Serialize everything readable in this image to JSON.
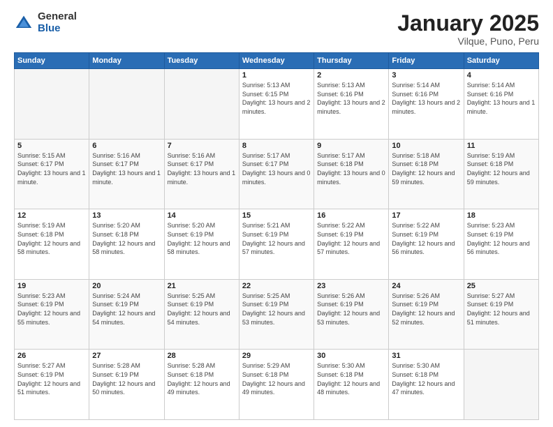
{
  "header": {
    "logo_general": "General",
    "logo_blue": "Blue",
    "month_title": "January 2025",
    "location": "Vilque, Puno, Peru"
  },
  "weekdays": [
    "Sunday",
    "Monday",
    "Tuesday",
    "Wednesday",
    "Thursday",
    "Friday",
    "Saturday"
  ],
  "weeks": [
    [
      {
        "day": "",
        "empty": true
      },
      {
        "day": "",
        "empty": true
      },
      {
        "day": "",
        "empty": true
      },
      {
        "day": "1",
        "sunrise": "5:13 AM",
        "sunset": "6:15 PM",
        "daylight": "13 hours and 2 minutes."
      },
      {
        "day": "2",
        "sunrise": "5:13 AM",
        "sunset": "6:16 PM",
        "daylight": "13 hours and 2 minutes."
      },
      {
        "day": "3",
        "sunrise": "5:14 AM",
        "sunset": "6:16 PM",
        "daylight": "13 hours and 2 minutes."
      },
      {
        "day": "4",
        "sunrise": "5:14 AM",
        "sunset": "6:16 PM",
        "daylight": "13 hours and 1 minute."
      }
    ],
    [
      {
        "day": "5",
        "sunrise": "5:15 AM",
        "sunset": "6:17 PM",
        "daylight": "13 hours and 1 minute."
      },
      {
        "day": "6",
        "sunrise": "5:16 AM",
        "sunset": "6:17 PM",
        "daylight": "13 hours and 1 minute."
      },
      {
        "day": "7",
        "sunrise": "5:16 AM",
        "sunset": "6:17 PM",
        "daylight": "13 hours and 1 minute."
      },
      {
        "day": "8",
        "sunrise": "5:17 AM",
        "sunset": "6:17 PM",
        "daylight": "13 hours and 0 minutes."
      },
      {
        "day": "9",
        "sunrise": "5:17 AM",
        "sunset": "6:18 PM",
        "daylight": "13 hours and 0 minutes."
      },
      {
        "day": "10",
        "sunrise": "5:18 AM",
        "sunset": "6:18 PM",
        "daylight": "12 hours and 59 minutes."
      },
      {
        "day": "11",
        "sunrise": "5:19 AM",
        "sunset": "6:18 PM",
        "daylight": "12 hours and 59 minutes."
      }
    ],
    [
      {
        "day": "12",
        "sunrise": "5:19 AM",
        "sunset": "6:18 PM",
        "daylight": "12 hours and 58 minutes."
      },
      {
        "day": "13",
        "sunrise": "5:20 AM",
        "sunset": "6:18 PM",
        "daylight": "12 hours and 58 minutes."
      },
      {
        "day": "14",
        "sunrise": "5:20 AM",
        "sunset": "6:19 PM",
        "daylight": "12 hours and 58 minutes."
      },
      {
        "day": "15",
        "sunrise": "5:21 AM",
        "sunset": "6:19 PM",
        "daylight": "12 hours and 57 minutes."
      },
      {
        "day": "16",
        "sunrise": "5:22 AM",
        "sunset": "6:19 PM",
        "daylight": "12 hours and 57 minutes."
      },
      {
        "day": "17",
        "sunrise": "5:22 AM",
        "sunset": "6:19 PM",
        "daylight": "12 hours and 56 minutes."
      },
      {
        "day": "18",
        "sunrise": "5:23 AM",
        "sunset": "6:19 PM",
        "daylight": "12 hours and 56 minutes."
      }
    ],
    [
      {
        "day": "19",
        "sunrise": "5:23 AM",
        "sunset": "6:19 PM",
        "daylight": "12 hours and 55 minutes."
      },
      {
        "day": "20",
        "sunrise": "5:24 AM",
        "sunset": "6:19 PM",
        "daylight": "12 hours and 54 minutes."
      },
      {
        "day": "21",
        "sunrise": "5:25 AM",
        "sunset": "6:19 PM",
        "daylight": "12 hours and 54 minutes."
      },
      {
        "day": "22",
        "sunrise": "5:25 AM",
        "sunset": "6:19 PM",
        "daylight": "12 hours and 53 minutes."
      },
      {
        "day": "23",
        "sunrise": "5:26 AM",
        "sunset": "6:19 PM",
        "daylight": "12 hours and 53 minutes."
      },
      {
        "day": "24",
        "sunrise": "5:26 AM",
        "sunset": "6:19 PM",
        "daylight": "12 hours and 52 minutes."
      },
      {
        "day": "25",
        "sunrise": "5:27 AM",
        "sunset": "6:19 PM",
        "daylight": "12 hours and 51 minutes."
      }
    ],
    [
      {
        "day": "26",
        "sunrise": "5:27 AM",
        "sunset": "6:19 PM",
        "daylight": "12 hours and 51 minutes."
      },
      {
        "day": "27",
        "sunrise": "5:28 AM",
        "sunset": "6:19 PM",
        "daylight": "12 hours and 50 minutes."
      },
      {
        "day": "28",
        "sunrise": "5:28 AM",
        "sunset": "6:18 PM",
        "daylight": "12 hours and 49 minutes."
      },
      {
        "day": "29",
        "sunrise": "5:29 AM",
        "sunset": "6:18 PM",
        "daylight": "12 hours and 49 minutes."
      },
      {
        "day": "30",
        "sunrise": "5:30 AM",
        "sunset": "6:18 PM",
        "daylight": "12 hours and 48 minutes."
      },
      {
        "day": "31",
        "sunrise": "5:30 AM",
        "sunset": "6:18 PM",
        "daylight": "12 hours and 47 minutes."
      },
      {
        "day": "",
        "empty": true
      }
    ]
  ]
}
